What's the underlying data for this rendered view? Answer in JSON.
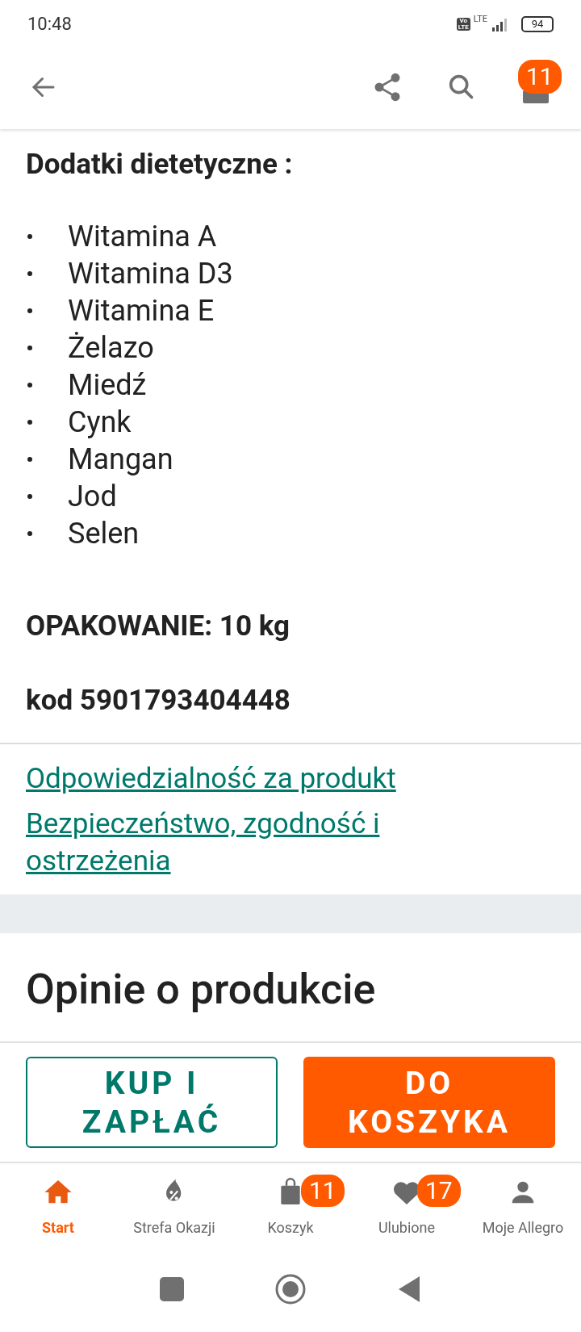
{
  "status_bar": {
    "time": "10:48",
    "volte": [
      "Vo",
      "LTE"
    ],
    "network": "LTE",
    "battery": "94"
  },
  "top_bar": {
    "cart_badge": "11"
  },
  "content": {
    "heading": "Dodatki dietetyczne :",
    "items": [
      "Witamina A",
      "Witamina D3",
      "Witamina E",
      "Żelazo",
      "Miedź",
      "Cynk",
      "Mangan",
      "Jod",
      "Selen"
    ],
    "packaging": "OPAKOWANIE: 10 kg",
    "code": "kod 5901793404448"
  },
  "links": [
    "Odpowiedzialność za produkt",
    "Bezpieczeństwo, zgodność i ostrzeżenia"
  ],
  "reviews": {
    "title": "Opinie o produkcie"
  },
  "actions": [
    {
      "kind": "outline",
      "label": "KUP I ZAPŁAĆ"
    },
    {
      "kind": "filled",
      "label": "DO KOSZYKA"
    }
  ],
  "bottom_nav": [
    {
      "kind": "home",
      "label": "Start",
      "selected": true
    },
    {
      "kind": "deals",
      "label": "Strefa Okazji",
      "selected": false
    },
    {
      "kind": "cart",
      "label": "Koszyk",
      "selected": false,
      "badge": "11"
    },
    {
      "kind": "heart",
      "label": "Ulubione",
      "selected": false,
      "badge": "17"
    },
    {
      "kind": "user",
      "label": "Moje Allegro",
      "selected": false
    }
  ]
}
